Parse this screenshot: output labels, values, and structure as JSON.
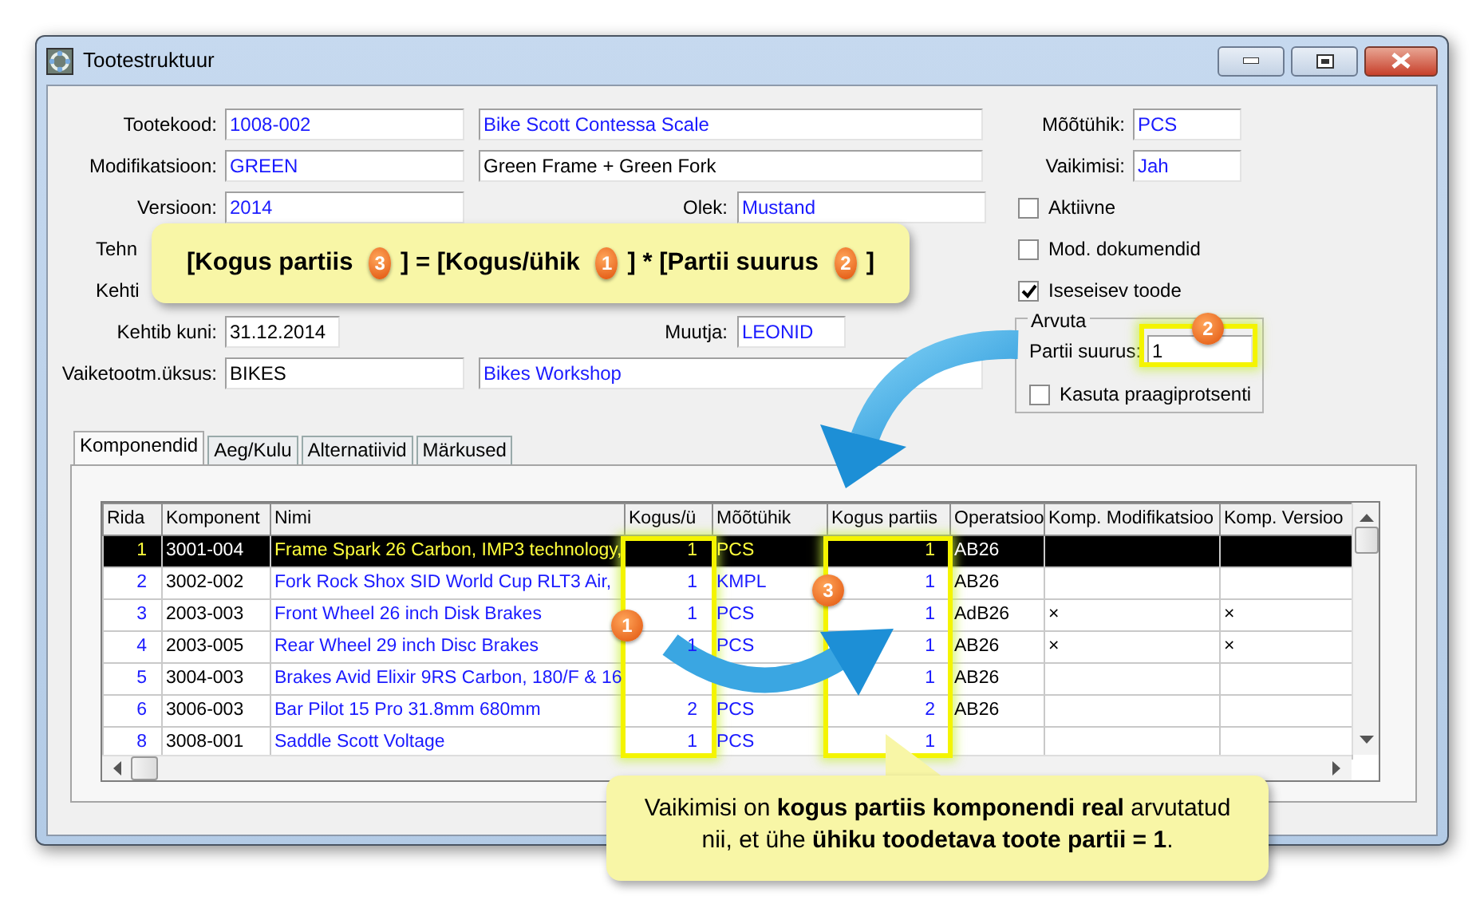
{
  "window": {
    "title": "Tootestruktuur"
  },
  "form_rows": [
    {
      "kind": "pair",
      "label": "Tootekood:",
      "code": {
        "value": "1008-002",
        "linked": true
      },
      "name": {
        "value": "Bike Scott Contessa Scale",
        "linked": true
      }
    },
    {
      "kind": "pair",
      "label": "Modifikatsioon:",
      "code": {
        "value": "GREEN",
        "linked": true
      },
      "name": {
        "value": "Green Frame + Green Fork",
        "linked": false
      }
    },
    {
      "kind": "side",
      "label": "Versioon:",
      "code": {
        "value": "2014",
        "linked": true
      },
      "side": {
        "label": "Olek:",
        "value": "Mustand",
        "linked": true
      }
    },
    {
      "kind": "covered",
      "label": "Tehn"
    },
    {
      "kind": "covered",
      "label": "Kehti"
    },
    {
      "kind": "side_short",
      "label": "Kehtib kuni:",
      "code": {
        "value": "31.12.2014",
        "linked": false
      },
      "side": {
        "label": "Muutja:",
        "value": "LEONID",
        "linked": true
      }
    },
    {
      "kind": "pair",
      "label": "Vaiketootm.üksus:",
      "code": {
        "value": "BIKES",
        "linked": false
      },
      "name": {
        "value": "Bikes Workshop",
        "linked": true
      }
    }
  ],
  "unit_fields": [
    {
      "label": "Mõõtühik:",
      "value": "PCS"
    },
    {
      "label": "Vaikimisi:",
      "value": "Jah"
    }
  ],
  "checkboxes": [
    {
      "label": "Aktiivne",
      "checked": false
    },
    {
      "label": "Mod. dokumendid",
      "checked": false
    },
    {
      "label": "Iseseisev toode",
      "checked": true
    }
  ],
  "arvuta": {
    "title": "Arvuta",
    "label": "Partii suurus:",
    "value": "1",
    "checkbox": {
      "label": "Kasuta praagiprotsenti",
      "checked": false
    }
  },
  "tabs": [
    {
      "label": "Komponendid",
      "selected": true
    },
    {
      "label": "Aeg/Kulu",
      "selected": false
    },
    {
      "label": "Alternatiivid",
      "selected": false
    },
    {
      "label": "Märkused",
      "selected": false
    }
  ],
  "grid": {
    "columns": [
      "Rida",
      "Komponent",
      "Nimi",
      "Kogus/ü",
      "Mõõtühik",
      "Kogus partiis",
      "Operatsioo",
      "Komp. Modifikatsioo",
      "Komp. Versioo"
    ],
    "rows": [
      {
        "selected": true,
        "cells": [
          "1",
          "3001-004",
          "Frame Spark 26 Carbon, IMP3 technology,",
          "1",
          "PCS",
          "1",
          "AB26",
          null,
          null
        ]
      },
      {
        "selected": false,
        "cells": [
          "2",
          "3002-002",
          "Fork Rock Shox SID World Cup RLT3 Air,",
          "1",
          "KMPL",
          "1",
          "AB26",
          null,
          null
        ]
      },
      {
        "selected": false,
        "cells": [
          "3",
          "2003-003",
          "Front Wheel 26 inch Disk Brakes",
          "1",
          "PCS",
          "1",
          "AdB26",
          "×",
          "×"
        ]
      },
      {
        "selected": false,
        "cells": [
          "4",
          "2003-005",
          "Rear Wheel 29 inch Disc Brakes",
          "1",
          "PCS",
          "1",
          "AB26",
          "×",
          "×"
        ]
      },
      {
        "selected": false,
        "cells": [
          "5",
          "3004-003",
          "Brakes Avid Elixir 9RS Carbon, 180/F & 16",
          null,
          null,
          "1",
          "AB26",
          null,
          null
        ]
      },
      {
        "selected": false,
        "cells": [
          "6",
          "3006-003",
          "Bar Pilot 15 Pro 31.8mm 680mm",
          "2",
          "PCS",
          "2",
          "AB26",
          null,
          null
        ]
      },
      {
        "selected": false,
        "cells": [
          "8",
          "3008-001",
          "Saddle Scott Voltage",
          "1",
          "PCS",
          "1",
          null,
          null,
          null
        ]
      }
    ]
  },
  "annotations": {
    "formula": [
      {
        "text": "[Kogus partiis",
        "badge": "3"
      },
      {
        "text": "] = [Kogus/ühik",
        "badge": "1"
      },
      {
        "text": "] * [Partii suurus",
        "badge": "2"
      },
      {
        "text": "]"
      }
    ],
    "badges": [
      {
        "kind": "quantity",
        "text": "1"
      },
      {
        "kind": "batch",
        "text": "2"
      },
      {
        "kind": "total",
        "text": "3"
      }
    ],
    "note": "Vaikimisi on **kogus partiis komponendi  real** arvutatud nii, et ühe **ühiku toodetava toote partii = 1**."
  }
}
